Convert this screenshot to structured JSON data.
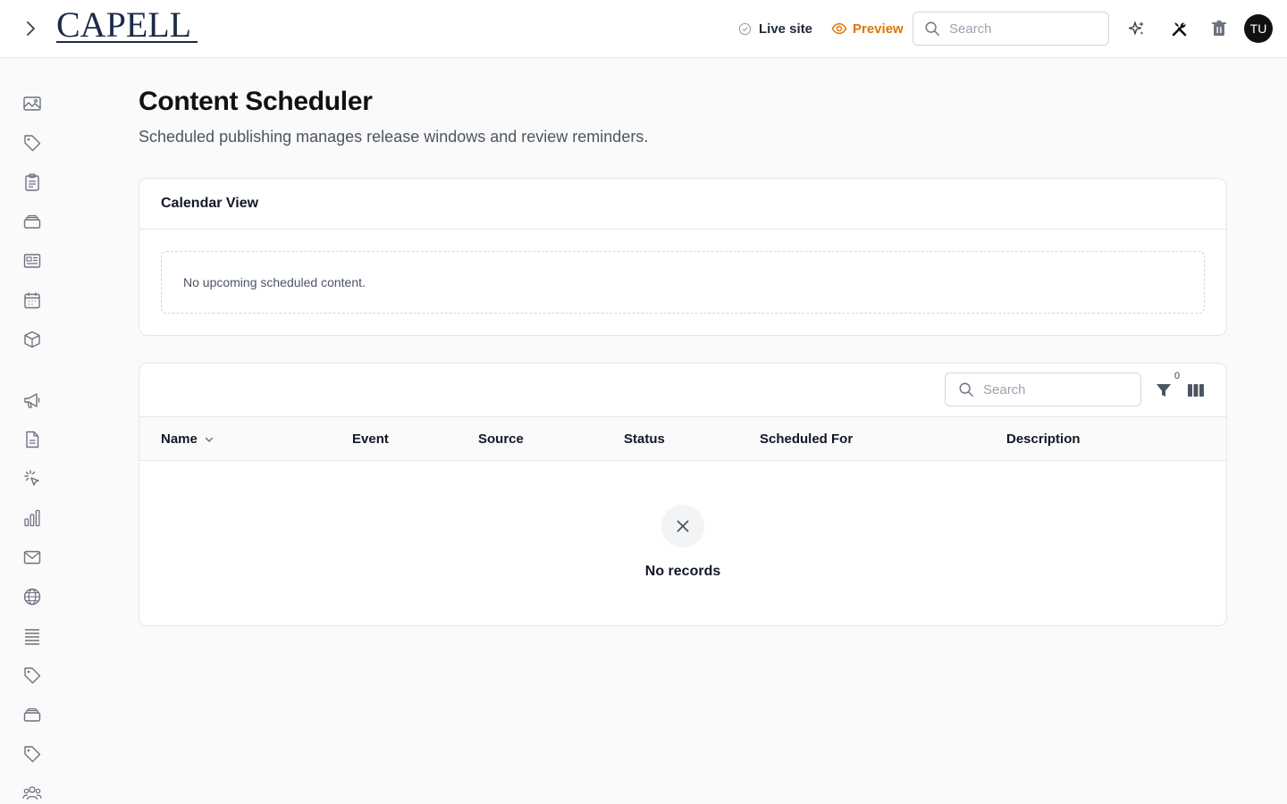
{
  "brand": {
    "logo_text": "CAPELL"
  },
  "header": {
    "live_site_label": "Live site",
    "preview_label": "Preview",
    "search_placeholder": "Search",
    "avatar_initials": "TU"
  },
  "colors": {
    "accent_preview": "#d97706",
    "logo": "#1b2a4a",
    "avatar_bg": "#111111"
  },
  "sidebar": {
    "items": [
      {
        "name": "media",
        "icon": "image-icon"
      },
      {
        "name": "tags",
        "icon": "tag-icon"
      },
      {
        "name": "clipboard",
        "icon": "clipboard-icon"
      },
      {
        "name": "archive",
        "icon": "stack-icon"
      },
      {
        "name": "news",
        "icon": "newspaper-icon"
      },
      {
        "name": "calendar",
        "icon": "calendar-icon"
      },
      {
        "name": "products",
        "icon": "cube-icon"
      },
      {
        "name": "announcements",
        "icon": "megaphone-icon"
      },
      {
        "name": "documents",
        "icon": "document-icon"
      },
      {
        "name": "clicks",
        "icon": "cursor-click-icon"
      },
      {
        "name": "analytics",
        "icon": "bar-chart-icon"
      },
      {
        "name": "mail",
        "icon": "mail-icon"
      },
      {
        "name": "web",
        "icon": "globe-icon"
      },
      {
        "name": "list",
        "icon": "list-icon"
      },
      {
        "name": "tags-2",
        "icon": "tag-icon"
      },
      {
        "name": "archive-2",
        "icon": "stack-icon"
      },
      {
        "name": "tags-3",
        "icon": "tag-icon"
      },
      {
        "name": "users",
        "icon": "users-icon"
      }
    ]
  },
  "page": {
    "title": "Content Scheduler",
    "subtitle": "Scheduled publishing manages release windows and review reminders."
  },
  "calendar": {
    "title": "Calendar View",
    "empty_text": "No upcoming scheduled content."
  },
  "table": {
    "search_placeholder": "Search",
    "filter_count": "0",
    "columns": [
      "Name",
      "Event",
      "Source",
      "Status",
      "Scheduled For",
      "Description"
    ],
    "empty_text": "No records"
  }
}
